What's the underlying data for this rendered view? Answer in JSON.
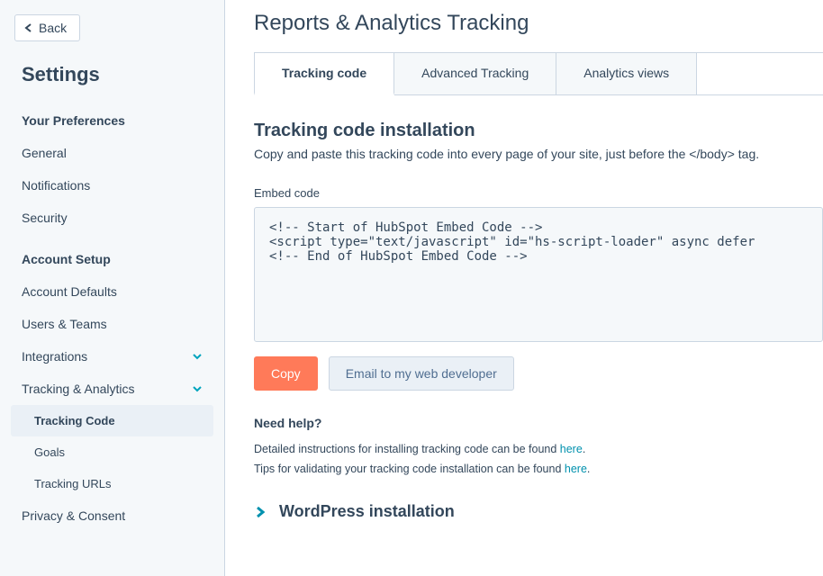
{
  "sidebar": {
    "back_label": "Back",
    "title": "Settings",
    "pref_label": "Your Preferences",
    "pref_items": [
      "General",
      "Notifications",
      "Security"
    ],
    "account_label": "Account Setup",
    "account_items": [
      {
        "label": "Account Defaults",
        "expandable": false
      },
      {
        "label": "Users & Teams",
        "expandable": false
      },
      {
        "label": "Integrations",
        "expandable": true
      },
      {
        "label": "Tracking & Analytics",
        "expandable": true
      }
    ],
    "tracking_sub": [
      "Tracking Code",
      "Goals",
      "Tracking URLs"
    ],
    "privacy": "Privacy & Consent"
  },
  "main": {
    "title": "Reports & Analytics Tracking",
    "tabs": [
      "Tracking code",
      "Advanced Tracking",
      "Analytics views"
    ],
    "section_title": "Tracking code installation",
    "section_desc": "Copy and paste this tracking code into every page of your site, just before the </body> tag.",
    "embed_label": "Embed code",
    "embed_code": "<!-- Start of HubSpot Embed Code -->\n<script type=\"text/javascript\" id=\"hs-script-loader\" async defer \n<!-- End of HubSpot Embed Code -->",
    "copy_btn": "Copy",
    "email_btn": "Email to my web developer",
    "help_title": "Need help?",
    "help1_pre": "Detailed instructions for installing tracking code can be found ",
    "help1_link": "here",
    "help2_pre": "Tips for validating your tracking code installation can be found ",
    "help2_link": "here",
    "accordion": "WordPress installation"
  }
}
